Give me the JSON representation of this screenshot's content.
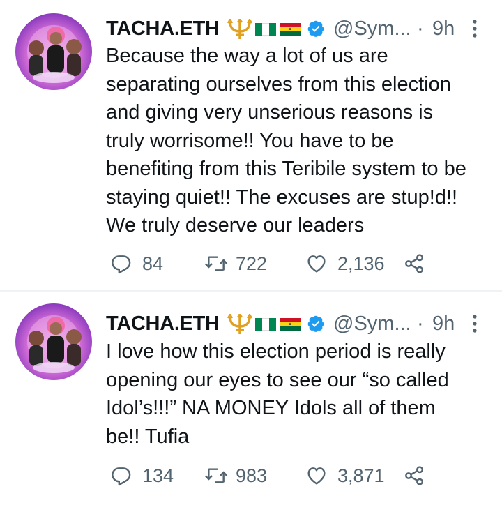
{
  "tweets": [
    {
      "display_name": "TACHA.ETH",
      "handle": "@Sym...",
      "separator": "·",
      "time": "9h",
      "text": "Because the way a lot of us are\nseparating ourselves from this election\nand giving very unserious reasons is\ntruly worrisome!! You have to be\nbenefiting from this Teribile system to be\nstaying quiet!! The excuses are stup!d!!\nWe truly deserve our leaders",
      "replies": "84",
      "retweets": "722",
      "likes": "2,136"
    },
    {
      "display_name": "TACHA.ETH",
      "handle": "@Sym...",
      "separator": "·",
      "time": "9h",
      "text": "I love how this election period is really\nopening our eyes to see our “so called\nIdol’s!!!” NA MONEY Idols all of them\nbe!! Tufia",
      "replies": "134",
      "retweets": "983",
      "likes": "3,871"
    }
  ],
  "icons": {
    "verified": "verified-badge-icon",
    "trident": "trident-emoji",
    "flag_1": "nigeria-flag",
    "flag_2": "ghana-flag",
    "more": "more-vertical-icon",
    "reply": "reply-icon",
    "retweet": "retweet-icon",
    "like": "heart-icon",
    "share": "share-icon"
  },
  "colors": {
    "text": "#0f1419",
    "secondary": "#536471",
    "verified": "#1d9bf0",
    "divider": "#eff3f4"
  }
}
